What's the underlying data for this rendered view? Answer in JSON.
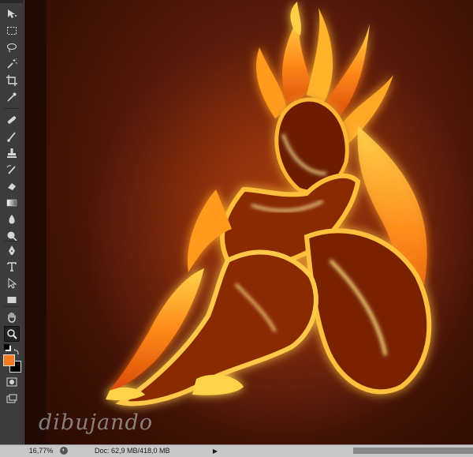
{
  "status": {
    "zoom": "16,77%",
    "doc_info": "Doc: 62,9 MB/418,0 MB"
  },
  "tools": [
    {
      "name": "move-tool-icon",
      "glyph": "▸"
    },
    {
      "name": "rectangular-marquee-icon",
      "glyph": "⬚"
    },
    {
      "name": "lasso-icon",
      "glyph": "◯"
    },
    {
      "name": "magic-wand-icon",
      "glyph": "✱"
    },
    {
      "name": "crop-icon",
      "glyph": "⌗"
    },
    {
      "name": "eyedropper-icon",
      "glyph": "⁄"
    },
    {
      "name": "healing-brush-icon",
      "glyph": "✚"
    },
    {
      "name": "brush-icon",
      "glyph": "✎"
    },
    {
      "name": "clone-stamp-icon",
      "glyph": "⊥"
    },
    {
      "name": "history-brush-icon",
      "glyph": "✐"
    },
    {
      "name": "eraser-icon",
      "glyph": "▱"
    },
    {
      "name": "gradient-icon",
      "glyph": "▥"
    },
    {
      "name": "blur-icon",
      "glyph": "◖"
    },
    {
      "name": "dodge-icon",
      "glyph": "●"
    },
    {
      "name": "pen-icon",
      "glyph": "✒"
    },
    {
      "name": "type-icon",
      "glyph": "T"
    },
    {
      "name": "path-selection-icon",
      "glyph": "▷"
    },
    {
      "name": "rectangle-shape-icon",
      "glyph": "▭"
    },
    {
      "name": "hand-icon",
      "glyph": "✋"
    },
    {
      "name": "zoom-icon",
      "glyph": "⌕"
    },
    {
      "name": "quick-mask-icon",
      "glyph": "◙"
    },
    {
      "name": "screen-mode-icon",
      "glyph": "▣"
    }
  ],
  "colors": {
    "foreground": "#f47a20",
    "background": "#000000"
  },
  "watermark": "dibujando"
}
